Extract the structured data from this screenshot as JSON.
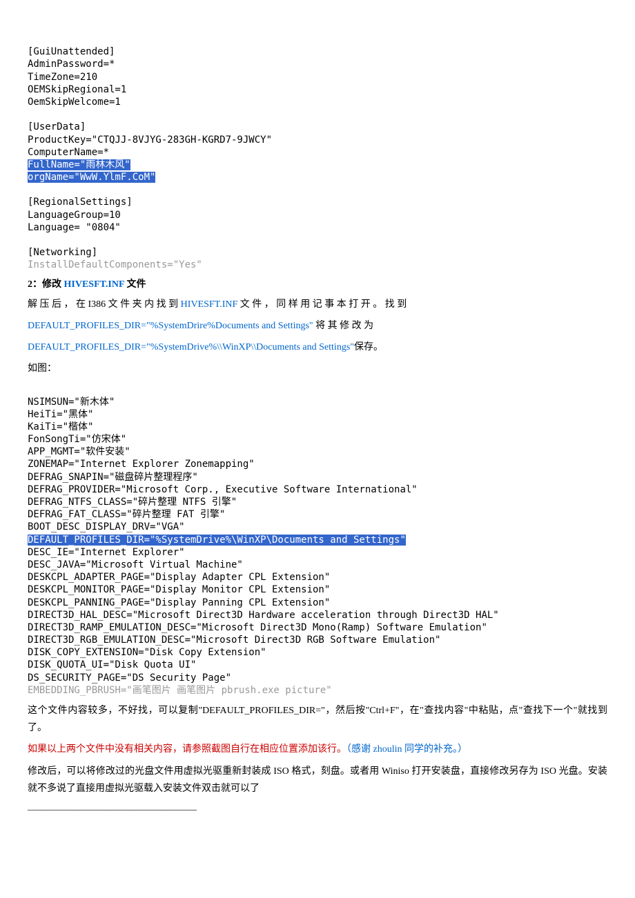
{
  "code1": {
    "l1": "[GuiUnattended]",
    "l2": "AdminPassword=*",
    "l3": "TimeZone=210",
    "l4": "OEMSkipRegional=1",
    "l5": "OemSkipWelcome=1",
    "l6": "",
    "l7": "[UserData]",
    "l8": "ProductKey=\"CTQJJ-8VJYG-283GH-KGRD7-9JWCY\"",
    "l9": "ComputerName=*",
    "l10": "FullName=\"雨林木风\"",
    "l11": "orgName=\"WwW.YlmF.CoM\"",
    "l12": "",
    "l13": "[RegionalSettings]",
    "l14": "LanguageGroup=10",
    "l15": "Language= \"0804\"",
    "l16": "",
    "l17": "[Networking]",
    "l18": "InstallDefaultComponents=\"Yes\""
  },
  "sec2": {
    "title_num": "2：",
    "title_text1": "修改 ",
    "title_file": "HIVESFT.INF",
    "title_text2": " 文件",
    "p1a": "  解  压  后  ，  在 ",
    "p1b": "I386",
    "p1c": "    文  件  夹  内  找  到 ",
    "p1d": "HIVESFT.INF",
    "p1e": "    文  件  ，   同  样  用  记  事  本  打  开  。   找  到",
    "p2a": "DEFAULT_PROFILES_DIR=\"%SystemDrire%Documents       and       Settings\"",
    "p2b": "      将      其      修      改      为",
    "p3": "DEFAULT_PROFILES_DIR=\"%SystemDrive%\\\\WinXP\\\\Documents and Settings\"",
    "p3b": "保存。",
    "p4": "如图："
  },
  "code2": {
    "l1": "NSIMSUN=\"新木体\"",
    "l2": "HeiTi=\"黑体\"",
    "l3": "KaiTi=\"楷体\"",
    "l4": "FonSongTi=\"仿宋体\"",
    "l5": "APP_MGMT=\"软件安装\"",
    "l6": "ZONEMAP=\"Internet Explorer Zonemapping\"",
    "l7": "DEFRAG_SNAPIN=\"磁盘碎片整理程序\"",
    "l8": "DEFRAG_PROVIDER=\"Microsoft Corp., Executive Software International\"",
    "l9": "DEFRAG_NTFS_CLASS=\"碎片整理 NTFS 引擎\"",
    "l10": "DEFRAG_FAT_CLASS=\"碎片整理 FAT 引擎\"",
    "l11": "BOOT_DESC_DISPLAY_DRV=\"VGA\"",
    "l12": "DEFAULT_PROFILES_DIR=\"%SystemDrive%\\WinXP\\Documents and Settings\"",
    "l13": "DESC_IE=\"Internet Explorer\"",
    "l14": "DESC_JAVA=\"Microsoft Virtual Machine\"",
    "l15": "DESKCPL_ADAPTER_PAGE=\"Display Adapter CPL Extension\"",
    "l16": "DESKCPL_MONITOR_PAGE=\"Display Monitor CPL Extension\"",
    "l17": "DESKCPL_PANNING_PAGE=\"Display Panning CPL Extension\"",
    "l18": "DIRECT3D_HAL_DESC=\"Microsoft Direct3D Hardware acceleration through Direct3D HAL\"",
    "l19": "DIRECT3D_RAMP_EMULATION_DESC=\"Microsoft Direct3D Mono(Ramp) Software Emulation\"",
    "l20": "DIRECT3D_RGB_EMULATION_DESC=\"Microsoft Direct3D RGB Software Emulation\"",
    "l21": "DISK_COPY_EXTENSION=\"Disk Copy Extension\"",
    "l22": "DISK_QUOTA_UI=\"Disk Quota UI\"",
    "l23": "DS_SECURITY_PAGE=\"DS Security Page\"",
    "l24": "EMBEDDING_PBRUSH=\"画笔图片 画笔图片 pbrush.exe picture\""
  },
  "after": {
    "p1": " 这个文件内容较多，不好找，可以复制\"DEFAULT_PROFILES_DIR=\"，然后按\"Ctrl+F\"，在\"查找内容\"中粘贴，点\"查找下一个\"就找到了。",
    "p2a": " 如果以上两个文件中没有相关内容，请参照截图自行在相应位置添加该行。",
    "p2b": "（感谢 ",
    "p2c": "zhoulin",
    "p2d": " 同学的补充。）",
    "p3": " 修改后，可以将修改过的光盘文件用虚拟光驱重新封装成 ISO 格式，刻盘。或者用 Winiso 打开安装盘，直接修改另存为 ISO 光盘。安装就不多说了直接用虚拟光驱载入安装文件双击就可以了",
    "p4": "—————————————————–"
  }
}
